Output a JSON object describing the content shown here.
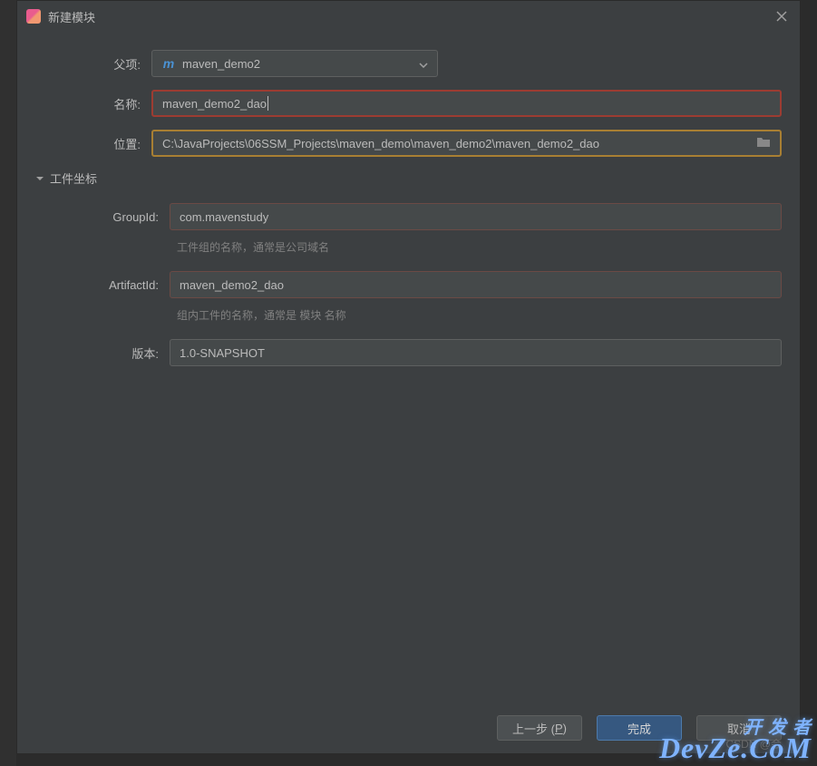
{
  "dialog": {
    "title": "新建模块"
  },
  "parent": {
    "label": "父项:",
    "value": "maven_demo2"
  },
  "name": {
    "label": "名称:",
    "value": "maven_demo2_dao"
  },
  "location": {
    "label": "位置:",
    "value": "C:\\JavaProjects\\06SSM_Projects\\maven_demo\\maven_demo2\\maven_demo2_dao"
  },
  "coordinates": {
    "section_label": "工件坐标",
    "groupId": {
      "label": "GroupId:",
      "value": "com.mavenstudy",
      "hint": "工件组的名称，通常是公司域名"
    },
    "artifactId": {
      "label": "ArtifactId:",
      "value": "maven_demo2_dao",
      "hint": "组内工件的名称，通常是 模块 名称"
    },
    "version": {
      "label": "版本:",
      "value": "1.0-SNAPSHOT"
    }
  },
  "buttons": {
    "previous": "上一步 (",
    "previous_key": "P",
    "previous_suffix": ")",
    "finish": "完成",
    "cancel": "取消"
  },
  "csdn": "CSDN @会",
  "watermark": {
    "top": "开 发 者",
    "bottom": "DevZe.CoM"
  }
}
